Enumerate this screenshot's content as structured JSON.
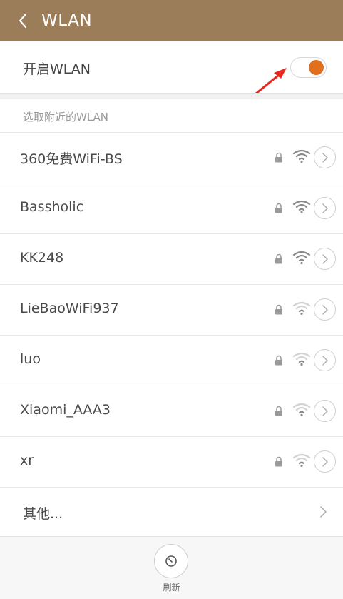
{
  "header": {
    "title": "WLAN"
  },
  "wlan_toggle": {
    "label": "开启WLAN",
    "enabled": true
  },
  "section": {
    "label": "选取附近的WLAN"
  },
  "networks": [
    {
      "ssid": "360免费WiFi-BS",
      "locked": true,
      "signal": 3
    },
    {
      "ssid": "Bassholic",
      "locked": true,
      "signal": 3
    },
    {
      "ssid": "KK248",
      "locked": true,
      "signal": 3
    },
    {
      "ssid": "LieBaoWiFi937",
      "locked": true,
      "signal": 1
    },
    {
      "ssid": "luo",
      "locked": true,
      "signal": 1
    },
    {
      "ssid": "Xiaomi_AAA3",
      "locked": true,
      "signal": 1
    },
    {
      "ssid": "xr",
      "locked": true,
      "signal": 1
    }
  ],
  "other": {
    "label": "其他..."
  },
  "footer": {
    "refresh_label": "刷新"
  },
  "colors": {
    "header_bg": "#9b7d59",
    "accent": "#e0701e",
    "arrow": "#e8281e"
  }
}
